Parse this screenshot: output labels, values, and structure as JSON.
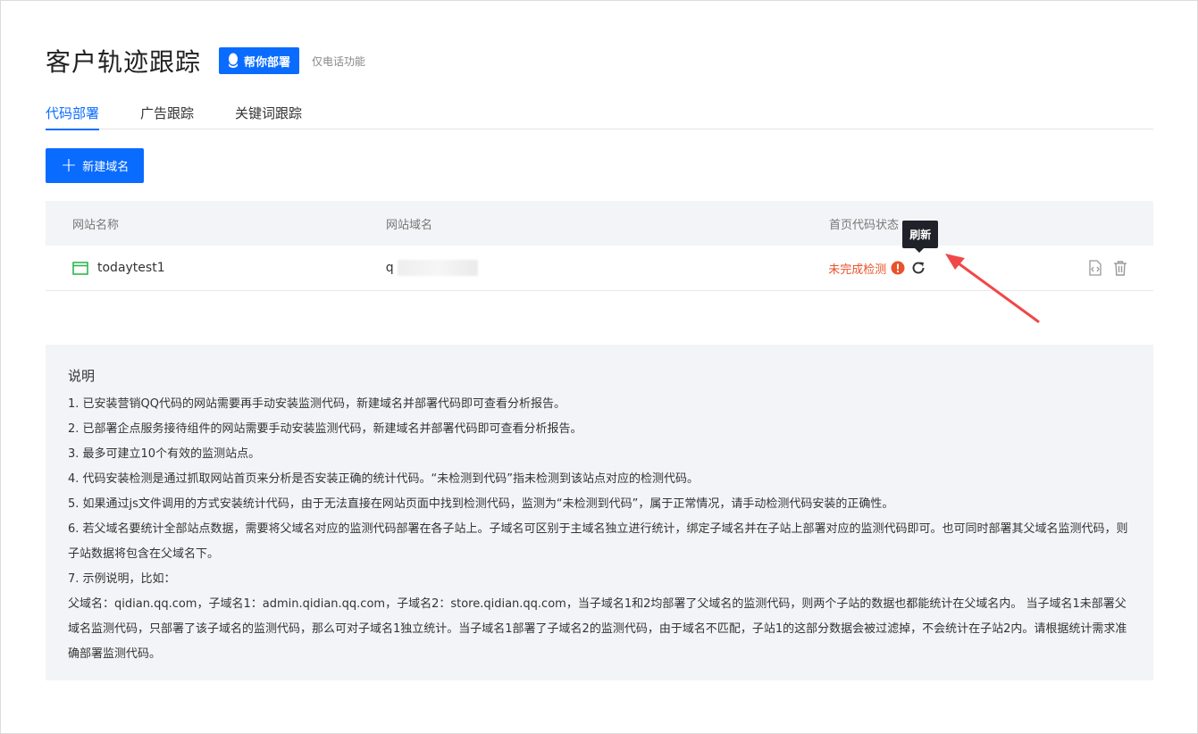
{
  "header": {
    "title": "客户轨迹跟踪",
    "help_button": "帮你部署",
    "note": "仅电话功能"
  },
  "tabs": [
    {
      "label": "代码部署",
      "active": true
    },
    {
      "label": "广告跟踪",
      "active": false
    },
    {
      "label": "关键词跟踪",
      "active": false
    }
  ],
  "toolbar": {
    "new_domain_button": "新建域名"
  },
  "table": {
    "columns": [
      "网站名称",
      "网站域名",
      "首页代码状态"
    ],
    "rows": [
      {
        "name": "todaytest1",
        "domain_prefix": "q",
        "status": "未完成检测"
      }
    ]
  },
  "tooltip": {
    "refresh": "刷新"
  },
  "colors": {
    "accent": "#0a6cff",
    "warning": "#e8532b",
    "annotation_arrow": "#f04848"
  },
  "notes": {
    "title": "说明",
    "lines": [
      "1. 已安装营销QQ代码的网站需要再手动安装监测代码，新建域名并部署代码即可查看分析报告。",
      "2. 已部署企点服务接待组件的网站需要手动安装监测代码，新建域名并部署代码即可查看分析报告。",
      "3. 最多可建立10个有效的监测站点。",
      "4. 代码安装检测是通过抓取网站首页来分析是否安装正确的统计代码。“未检测到代码”指未检测到该站点对应的检测代码。",
      "5. 如果通过js文件调用的方式安装统计代码，由于无法直接在网站页面中找到检测代码，监测为“未检测到代码”，属于正常情况，请手动检测代码安装的正确性。",
      "6. 若父域名要统计全部站点数据，需要将父域名对应的监测代码部署在各子站上。子域名可区别于主域名独立进行统计，绑定子域名并在子站上部署对应的监测代码即可。也可同时部署其父域名监测代码，则子站数据将包含在父域名下。",
      "7. 示例说明，比如：",
      "父域名：qidian.qq.com，子域名1：admin.qidian.qq.com，子域名2：store.qidian.qq.com，当子域名1和2均部署了父域名的监测代码，则两个子站的数据也都能统计在父域名内。 当子域名1未部署父域名监测代码，只部署了该子域名的监测代码，那么可对子域名1独立统计。当子域名1部署了子域名2的监测代码，由于域名不匹配，子站1的这部分数据会被过滤掉，不会统计在子站2内。请根据统计需求准确部署监测代码。"
    ]
  }
}
